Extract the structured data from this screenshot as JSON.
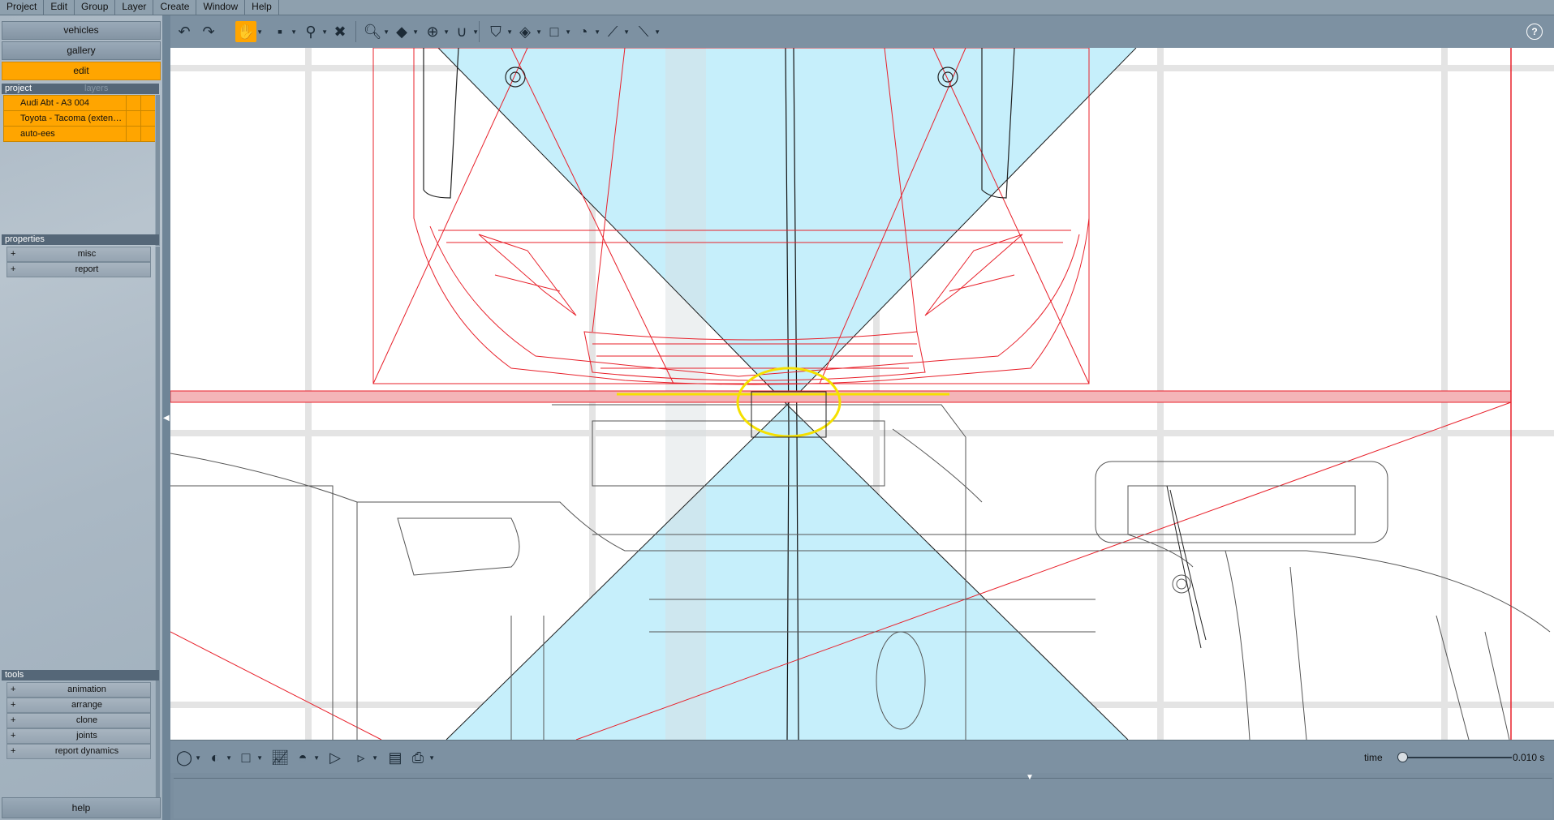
{
  "menu": [
    "Project",
    "Edit",
    "Group",
    "Layer",
    "Create",
    "Window",
    "Help"
  ],
  "nav": {
    "vehicles": "vehicles",
    "gallery": "gallery",
    "edit": "edit"
  },
  "project_panel": {
    "tab_project": "project",
    "tab_layers": "layers",
    "items": [
      "Audi Abt - A3 004",
      "Toyota - Tacoma (exten…",
      "auto-ees"
    ]
  },
  "properties_panel": {
    "header": "properties",
    "items": [
      "misc",
      "report"
    ]
  },
  "tools_panel": {
    "header": "tools",
    "items": [
      "animation",
      "arrange",
      "clone",
      "joints",
      "report dynamics"
    ]
  },
  "help_button": "help",
  "toolbar": {
    "icons": [
      "undo-icon",
      "redo-icon",
      "pan-hand-icon",
      "select-rect-icon",
      "pin-icon",
      "delete-icon",
      "zoom-icon",
      "cube-icon",
      "move-icon",
      "magnet-icon",
      "shield-icon",
      "surface-icon",
      "rectangle-icon",
      "gauge-icon",
      "measure-icon",
      "ruler-icon"
    ],
    "help_icon": "?"
  },
  "timeline": {
    "label": "time",
    "value": "0.010 s",
    "position_fraction": 0.0
  },
  "colors": {
    "accent": "#ffa500",
    "viewport_bg": "#ffffff",
    "wire_red": "#e8202a",
    "cone_blue": "#bfeefb",
    "highlight_yellow": "#f5e000"
  }
}
